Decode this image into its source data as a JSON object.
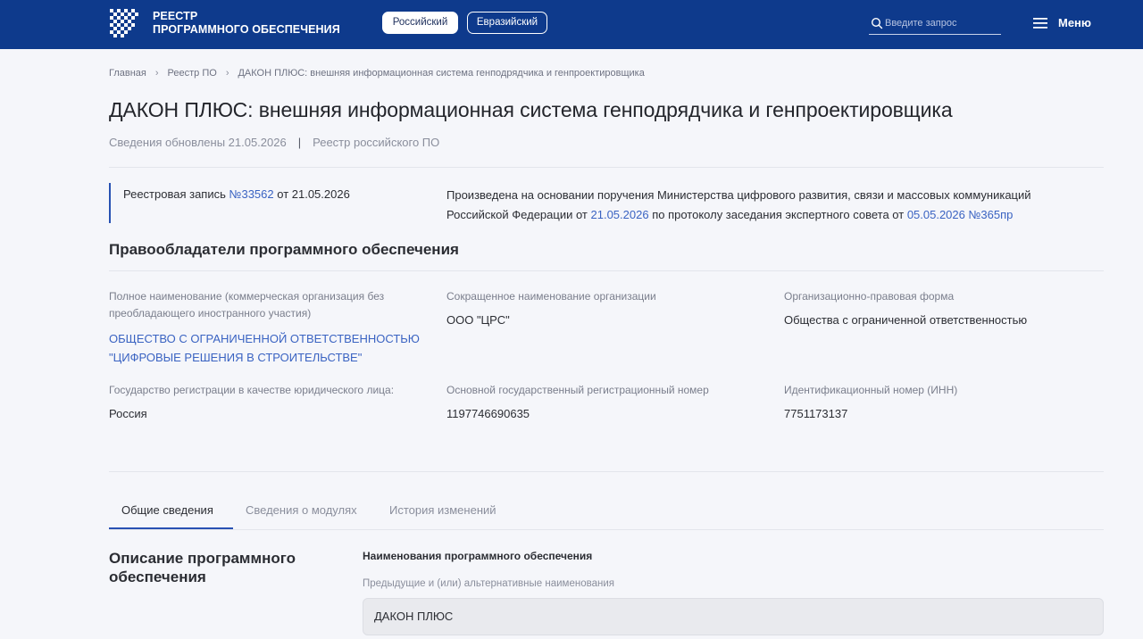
{
  "header": {
    "brand_line1": "РЕЕСТР",
    "brand_line2": "ПРОГРАММНОГО ОБЕСПЕЧЕНИЯ",
    "registry_tabs": [
      "Российский",
      "Евразийский"
    ],
    "active_registry": "Российский",
    "search_placeholder": "Введите запрос",
    "menu_label": "Меню",
    "background_color": "#0e3a8c"
  },
  "breadcrumb": [
    "Главная",
    "Реестр ПО",
    "ДАКОН ПЛЮС: внешняя информационная система генподрядчика и генпроектировщика"
  ],
  "page": {
    "title": "ДАКОН ПЛЮС: внешняя информационная система генподрядчика и генпроектировщика",
    "updated": "Сведения обновлены 21.05.2026",
    "registry": "Реестр российского ПО"
  },
  "registry_record": {
    "prefix": "Реестровая запись",
    "number": "№33562",
    "date_text": "от 21.05.2026"
  },
  "basis": {
    "line1": "Произведена на основании поручения Министерства цифрового развития, связи и массовых коммуникаций",
    "line2_prefix": "Российской Федерации от",
    "order_date": "21.05.2026",
    "line2_middle": "по протоколу заседания экспертного совета от",
    "protocol": "05.05.2026 №365пр"
  },
  "rightholders": {
    "heading": "Правообладатели программного обеспечения",
    "fields": [
      {
        "label": "Полное наименование (коммерческая организация без преобладающего иностранного участия)",
        "value": "ОБЩЕСТВО С ОГРАНИЧЕННОЙ ОТВЕТСТВЕННОСТЬЮ \"ЦИФРОВЫЕ РЕШЕНИЯ В СТРОИТЕЛЬСТВЕ\""
      },
      {
        "label": "Сокращенное наименование организации",
        "value": "ООО \"ЦРС\""
      },
      {
        "label": "Организационно-правовая форма",
        "value": "Общества с ограниченной ответственностью"
      },
      {
        "label": "Государство регистрации в качестве юридического лица:",
        "value": "Россия"
      },
      {
        "label": "Основной государственный регистрационный номер",
        "value": "1197746690635"
      },
      {
        "label": "Идентификационный номер (ИНН)",
        "value": "7751173137"
      }
    ]
  },
  "tabs": [
    {
      "label": "Общие сведения",
      "active": true
    },
    {
      "label": "Сведения о модулях",
      "active": false
    },
    {
      "label": "История изменений",
      "active": false
    }
  ],
  "description": {
    "heading": "Описание программного обеспечения",
    "names_heading": "Наименования программного обеспечения",
    "alt_names_label": "Предыдущие и (или) альтернативные наименования",
    "alt_name_value": "ДАКОН ПЛЮС"
  },
  "colors": {
    "accent": "#2851b3",
    "link": "#3a63c2"
  }
}
